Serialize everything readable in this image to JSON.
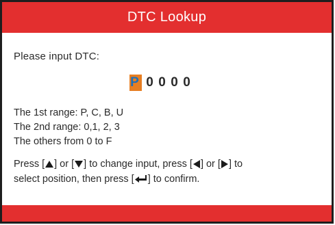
{
  "header": {
    "title": "DTC Lookup"
  },
  "prompt": "Please input DTC:",
  "dtc_input": {
    "chars": [
      "P",
      "0",
      "0",
      "0",
      "0"
    ],
    "active_index": 0
  },
  "ranges": [
    "The 1st range: P, C, B, U",
    "The 2nd range: 0,1, 2, 3",
    "The others from  0  to  F"
  ],
  "instructions": {
    "l1_a": "Press [",
    "l1_b": "] or [",
    "l1_c": "] to change input, press [",
    "l1_d": "] or [",
    "l1_e": "] to",
    "l2_a": "select position, then press [",
    "l2_b": "]  to  confirm."
  },
  "icons": {
    "up": "up-arrow-icon",
    "down": "down-arrow-icon",
    "left": "left-arrow-icon",
    "right": "right-arrow-icon",
    "enter": "enter-icon"
  },
  "colors": {
    "header_bg": "#e32f2f",
    "footer_bg": "#e32f2f",
    "cursor_bg": "#e67e22",
    "cursor_fg": "#1e6fb8"
  }
}
